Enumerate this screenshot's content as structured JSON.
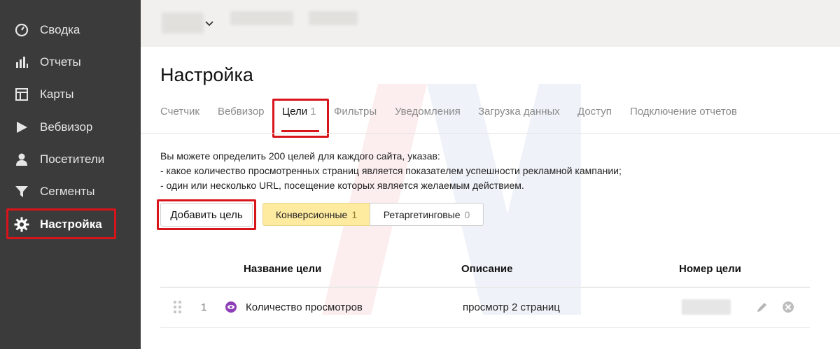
{
  "sidebar": {
    "items": [
      {
        "label": "Сводка",
        "icon": "gauge-icon"
      },
      {
        "label": "Отчеты",
        "icon": "bar-chart-icon"
      },
      {
        "label": "Карты",
        "icon": "map-layout-icon"
      },
      {
        "label": "Вебвизор",
        "icon": "play-icon"
      },
      {
        "label": "Посетители",
        "icon": "person-icon"
      },
      {
        "label": "Сегменты",
        "icon": "funnel-icon"
      },
      {
        "label": "Настройка",
        "icon": "gear-icon",
        "active": true
      }
    ]
  },
  "page": {
    "title": "Настройка"
  },
  "tabs": [
    {
      "label": "Счетчик"
    },
    {
      "label": "Вебвизор"
    },
    {
      "label": "Цели",
      "count": "1",
      "active": true
    },
    {
      "label": "Фильтры"
    },
    {
      "label": "Уведомления"
    },
    {
      "label": "Загрузка данных"
    },
    {
      "label": "Доступ"
    },
    {
      "label": "Подключение отчетов"
    }
  ],
  "description": {
    "line1": "Вы можете определить 200 целей для каждого сайта, указав:",
    "line2": "-  какое количество просмотренных страниц является показателем успешности рекламной кампании;",
    "line3": "-  один или несколько URL, посещение которых является желаемым действием."
  },
  "actions": {
    "add_goal": "Добавить цель",
    "filters": [
      {
        "label": "Конверсионные",
        "count": "1",
        "selected": true
      },
      {
        "label": "Ретаргетинговые",
        "count": "0",
        "selected": false
      }
    ]
  },
  "table": {
    "headers": {
      "name": "Название цели",
      "description": "Описание",
      "number": "Номер цели"
    },
    "rows": [
      {
        "index": "1",
        "name": "Количество просмотров",
        "description": "просмотр 2 страниц",
        "icon": "eye-icon"
      }
    ]
  },
  "colors": {
    "sidebar_bg": "#3b3b3b",
    "highlight_red": "#d8141b",
    "selected_filter_bg": "#ffeba0",
    "goal_icon": "#8e3fb8"
  }
}
